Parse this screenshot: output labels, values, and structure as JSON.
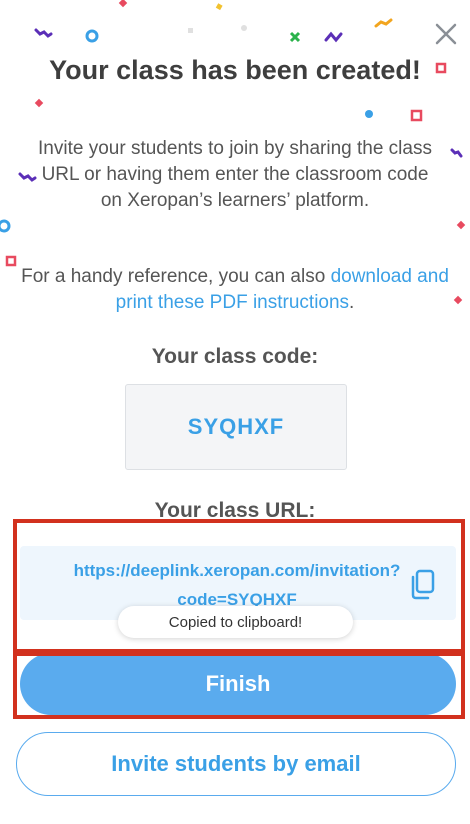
{
  "dialog": {
    "title": "Your class has been created!",
    "description": "Invite your students to join by sharing the class URL or having them enter the classroom code on Xeropan’s learners’ platform.",
    "reference_prefix": "For a handy reference, you can also ",
    "reference_link": "download and print these PDF instructions",
    "reference_suffix": "."
  },
  "class_code": {
    "label": "Your class code:",
    "value": "SYQHXF"
  },
  "class_url": {
    "label": "Your class URL:",
    "value": "https://deeplink.xeropan.com/invitation?code=SYQHXF"
  },
  "toast": {
    "message": "Copied to clipboard!"
  },
  "buttons": {
    "finish": "Finish",
    "invite_email": "Invite students by email"
  },
  "icons": {
    "close": "close-icon",
    "copy": "copy-icon"
  },
  "colors": {
    "accent": "#3aa0e6",
    "primary_button": "#5aabee",
    "highlight": "#d2311e",
    "title": "#3e3e3e"
  }
}
